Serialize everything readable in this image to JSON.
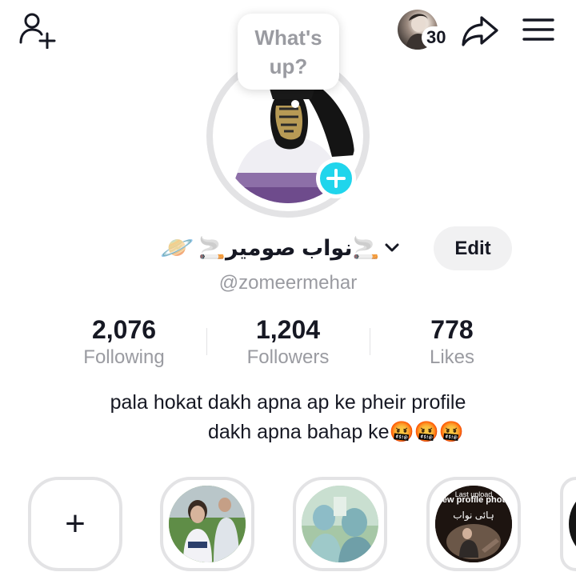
{
  "header": {
    "visitor_count": "30",
    "bubble_line1": "What's",
    "bubble_line2": "up?",
    "icons": [
      "add-user-icon",
      "share-icon",
      "menu-icon"
    ]
  },
  "profile": {
    "planet_emoji": "🪐",
    "display_name": "🚬نواب صومیر🚬",
    "username": "@zomeermehar",
    "edit_label": "Edit"
  },
  "stats": [
    {
      "value": "2,076",
      "label": "Following"
    },
    {
      "value": "1,204",
      "label": "Followers"
    },
    {
      "value": "778",
      "label": "Likes"
    }
  ],
  "bio": {
    "line1": "pala hokat dakh apna ap ke pheir profile",
    "line2": "dakh apna bahap ke🤬🤬🤬"
  },
  "highlights": {
    "add_label": "+",
    "item3_caption": "new profile photo",
    "item3_top": "Last upload",
    "item3_script": "ہائی نواب"
  },
  "colors": {
    "accent": "#20d5ec",
    "text": "#161823",
    "muted": "#9a9ba1",
    "border": "#e3e3e5",
    "button_bg": "#f1f1f2"
  }
}
